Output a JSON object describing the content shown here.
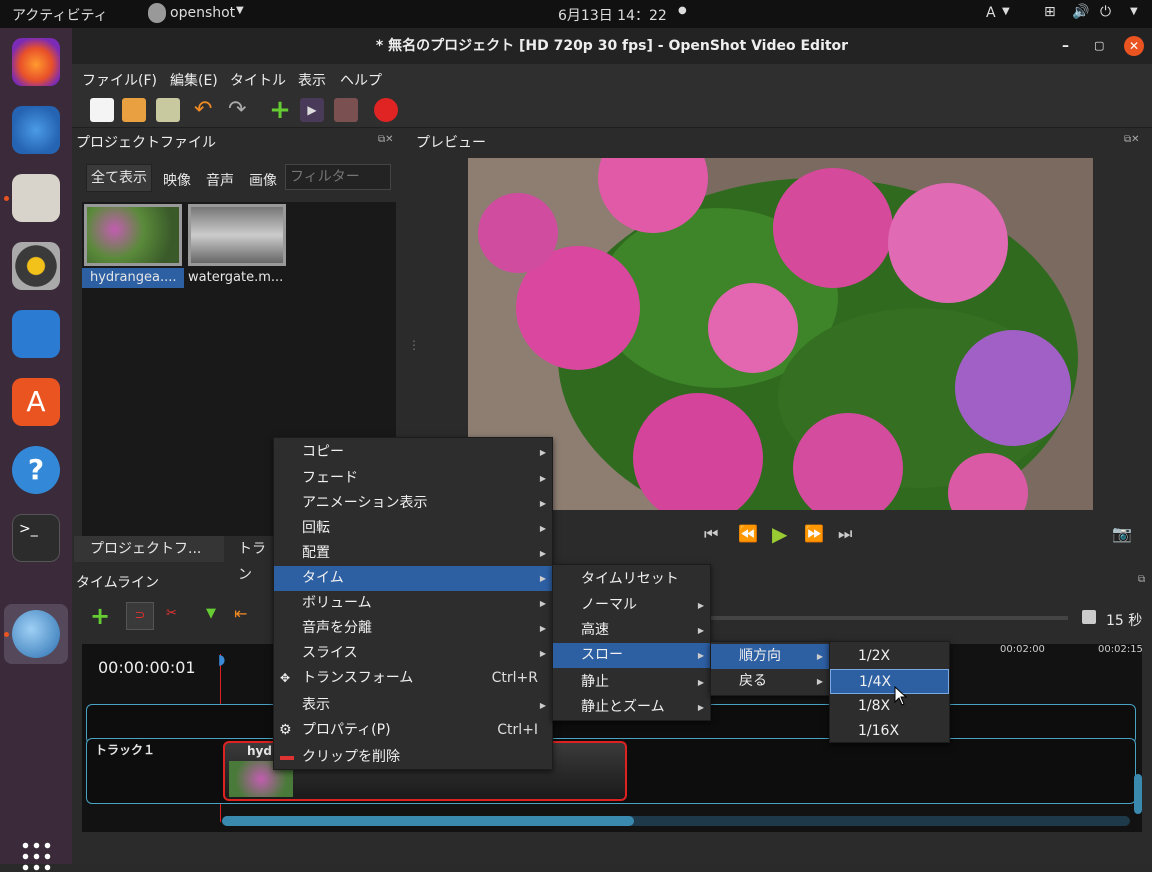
{
  "topbar": {
    "activities": "アクティビティ",
    "app": "openshot",
    "clock": "6月13日 14：22",
    "input": "A"
  },
  "window": {
    "title": "* 無名のプロジェクト [HD 720p 30 fps] - OpenShot Video Editor"
  },
  "menubar": [
    "ファイル(F)",
    "編集(E)",
    "タイトル",
    "表示",
    "ヘルプ"
  ],
  "project": {
    "header": "プロジェクトファイル",
    "filters": [
      "全て表示",
      "映像",
      "音声",
      "画像"
    ],
    "filter_placeholder": "フィルター",
    "files": [
      "hydrangea....",
      "watergate.m..."
    ],
    "tab1": "プロジェクトフ...",
    "tab2": "トラン"
  },
  "preview": {
    "header": "プレビュー"
  },
  "timeline": {
    "header": "タイムライン",
    "timecode": "00:00:00:01",
    "zoom": "15 秒",
    "ticks": [
      "00:02:00",
      "00:02:15"
    ],
    "track1": "トラック１",
    "clip": "hyd"
  },
  "context_menu": {
    "items": [
      {
        "label": "コピー",
        "sub": true
      },
      {
        "label": "フェード",
        "sub": true
      },
      {
        "label": "アニメーション表示",
        "sub": true
      },
      {
        "label": "回転",
        "sub": true
      },
      {
        "label": "配置",
        "sub": true
      },
      {
        "label": "タイム",
        "sub": true,
        "selected": true
      },
      {
        "label": "ボリューム",
        "sub": true
      },
      {
        "label": "音声を分離",
        "sub": true
      },
      {
        "label": "スライス",
        "sub": true
      },
      {
        "label": "トランスフォーム",
        "shortcut": "Ctrl+R"
      },
      {
        "label": "表示",
        "sub": true
      },
      {
        "label": "プロパティ(P)",
        "shortcut": "Ctrl+I"
      },
      {
        "label": "クリップを削除"
      }
    ]
  },
  "time_menu": {
    "items": [
      "タイムリセット",
      "ノーマル",
      "高速",
      "スロー",
      "静止",
      "静止とズーム"
    ]
  },
  "slow_menu": {
    "items": [
      "順方向",
      "戻る"
    ]
  },
  "speed_menu": {
    "items": [
      "1/2X",
      "1/4X",
      "1/8X",
      "1/16X"
    ]
  }
}
